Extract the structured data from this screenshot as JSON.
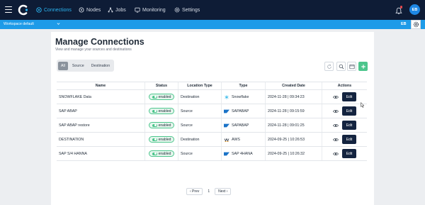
{
  "nav": {
    "items": [
      {
        "label": "Connections",
        "icon": "connections-icon",
        "active": true
      },
      {
        "label": "Nodes",
        "icon": "nodes-icon",
        "active": false
      },
      {
        "label": "Jobs",
        "icon": "jobs-icon",
        "active": false
      },
      {
        "label": "Monitoring",
        "icon": "monitoring-icon",
        "active": false
      },
      {
        "label": "Settings",
        "icon": "gear-icon",
        "active": false
      }
    ],
    "user_initials": "EB",
    "accent": "#2bb5f2",
    "bg": "#0e1c36"
  },
  "workspace": {
    "label": "Workspace default",
    "initials": "EB",
    "bar_color": "#1e9be8"
  },
  "page": {
    "title": "Manage Connections",
    "subtitle": "View and manage your sources and destinations"
  },
  "filters": [
    {
      "label": "All",
      "active": true
    },
    {
      "label": "Source",
      "active": false
    },
    {
      "label": "Destination",
      "active": false
    }
  ],
  "table": {
    "headers": [
      "Name",
      "Status",
      "Location Type",
      "Type",
      "Created Date",
      "Actions"
    ],
    "rows": [
      {
        "name": "SNOWFLAKE Data",
        "status": "enabled",
        "location": "Destination",
        "type": "Snowflake",
        "type_icon": "snowflake-icon",
        "created": "2024-11-28 | 09:34:23",
        "action": "Edit"
      },
      {
        "name": "SAP ABAP",
        "status": "enabled",
        "location": "Source",
        "type": "SAPABAP",
        "type_icon": "sap-icon",
        "created": "2024-11-28 | 09:15:59",
        "action": "Edit"
      },
      {
        "name": "SAP ABAP restore",
        "status": "enabled",
        "location": "Source",
        "type": "SAPABAP",
        "type_icon": "sap-icon",
        "created": "2024-11-28 | 09:01:25",
        "action": "Edit"
      },
      {
        "name": "DESTINATION",
        "status": "enabled",
        "location": "Destination",
        "type": "AWS",
        "type_icon": "aws-icon",
        "created": "2024-09-25 | 10:26:53",
        "action": "Edit"
      },
      {
        "name": "SAP S/4 HANNA",
        "status": "enabled",
        "location": "Source",
        "type": "SAP 4HANA",
        "type_icon": "sap-icon",
        "created": "2024-09-25 | 10:26:32",
        "action": "Edit"
      }
    ]
  },
  "pagination": {
    "prev": "‹ Prev",
    "page": "1",
    "next": "Next ›"
  },
  "colors": {
    "success": "#4cc58c",
    "edit_button": "#13233f"
  }
}
